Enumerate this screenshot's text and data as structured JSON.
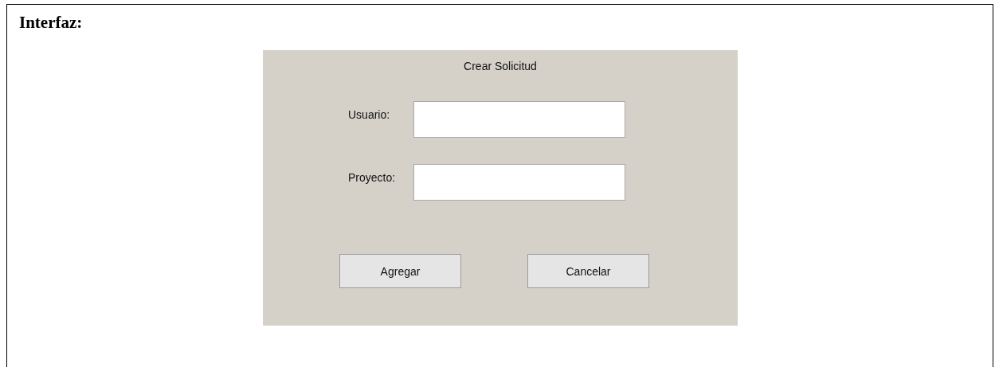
{
  "section": {
    "heading": "Interfaz:"
  },
  "dialog": {
    "title": "Crear Solicitud",
    "fields": [
      {
        "label": "Usuario:"
      },
      {
        "label": "Proyecto:"
      }
    ],
    "buttons": [
      "Agregar",
      "Cancelar"
    ]
  }
}
